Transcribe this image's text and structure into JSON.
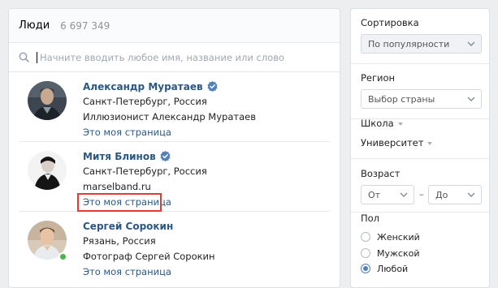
{
  "header": {
    "title": "Люди",
    "count": "6 697 349"
  },
  "search": {
    "placeholder": "Начните вводить любое имя, название или слово"
  },
  "people": [
    {
      "name": "Александр Муратаев",
      "verified": true,
      "city": "Санкт-Петербург, Россия",
      "detail": "Иллюзионист Александр Муратаев",
      "link": "Это моя страница",
      "online": false
    },
    {
      "name": "Митя Блинов",
      "verified": true,
      "city": "Санкт-Петербург, Россия",
      "detail": "marselband.ru",
      "link": "Это моя страница",
      "online": false,
      "highlighted": true
    },
    {
      "name": "Сергей Сорокин",
      "verified": false,
      "city": "Рязань, Россия",
      "detail": "Фотограф Сергей Сорокин",
      "link": "Это моя страница",
      "online": true
    }
  ],
  "filters": {
    "sort": {
      "title": "Сортировка",
      "value": "По популярности"
    },
    "region": {
      "title": "Регион",
      "placeholder": "Выбор страны"
    },
    "school": {
      "title": "Школа"
    },
    "university": {
      "title": "Университет"
    },
    "age": {
      "title": "Возраст",
      "from": "От",
      "to": "До",
      "dash": "–"
    },
    "gender": {
      "title": "Пол",
      "options": [
        "Женский",
        "Мужской",
        "Любой"
      ],
      "selected": "Любой"
    }
  },
  "colors": {
    "link": "#2a5885",
    "accent": "#5181b8",
    "verified": "#5181b8",
    "online": "#4bb34b",
    "highlight": "#e53935"
  }
}
